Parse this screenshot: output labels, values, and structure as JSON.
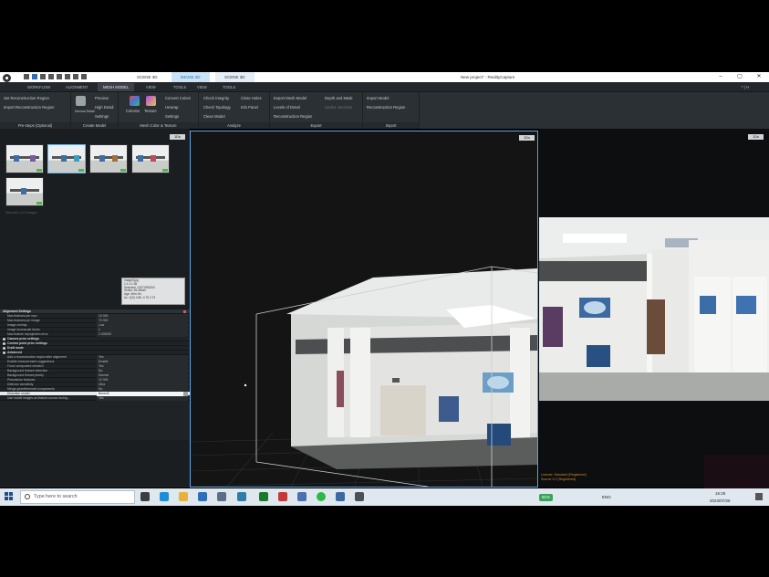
{
  "titlebar": {
    "tabs": [
      {
        "label": "SCENE 3D",
        "active": false
      },
      {
        "label": "IMAGE 2D",
        "active": true
      },
      {
        "label": "SCENE 3D",
        "active": false
      }
    ],
    "title": "New project* - RealityCapture",
    "minimize": "–",
    "maximize": "▢",
    "close": "✕"
  },
  "menu": {
    "tabs": [
      "WORKFLOW",
      "ALIGNMENT",
      "MESH MODEL",
      "VIEW",
      "TOOLS",
      "VIEW",
      "TOOLS"
    ],
    "active_index": 2,
    "help": "? | H"
  },
  "ribbon": {
    "prestep": {
      "items": [
        "Set Reconstruction Region",
        "Import Reconstruction Region"
      ],
      "label": "Pre-steps (Optional)"
    },
    "create": {
      "items": [
        "Preview",
        "High Detail",
        "Normal Detail",
        "Settings"
      ],
      "label": "Create Model"
    },
    "meshcolor": {
      "items": [
        "Colorize",
        "Texture"
      ],
      "label": "Mesh Color & Texture"
    },
    "tools": {
      "items": [
        "Convert Colors",
        "Unwrap",
        "Settings"
      ]
    },
    "analyze": {
      "items": [
        "Check Integrity",
        "Check Topology",
        "Clean Model",
        "Close Holes",
        "Info Panel"
      ],
      "label": "Analyze"
    },
    "export": {
      "items": [
        "Export Mesh Model",
        "Levels of Detail",
        "Reconstruction Region",
        "Depth and Mask",
        "Undist. Sections"
      ],
      "label": "Export"
    },
    "import": {
      "items": [
        "Import Model",
        "Reconstruction Region"
      ],
      "label": "Import"
    }
  },
  "leftpanel": {
    "view_badge": "1Ds",
    "hint": "Selected 1/13 images",
    "tooltip": [
      "Image0.jpg",
      "1:1:1:1:38",
      "Selected: 10071082200",
      "Vertex: 56 48mm",
      "Age: 46m 2m",
      "Ac: 1(2l) 0.86, 0.75 2.73"
    ]
  },
  "settings": {
    "header": "Alignment Settings",
    "rows": [
      {
        "k": "Max features per mpx",
        "v": "10 000"
      },
      {
        "k": "Max features per image",
        "v": "70 000"
      },
      {
        "k": "Image overlap",
        "v": "Low"
      },
      {
        "k": "Image downscale factor",
        "v": "1"
      },
      {
        "k": "Max feature reprojection error",
        "v": "2.000000"
      }
    ],
    "sections": [
      "Camera prior settings",
      "Control point prior settings",
      "Draft mode",
      "Advanced"
    ],
    "advanced": [
      {
        "k": "Add a reconstruction region after alignment",
        "v": "Yes"
      },
      {
        "k": "Enable measurement suggestions",
        "v": "Enable"
      },
      {
        "k": "Force component rematch",
        "v": "Yes"
      },
      {
        "k": "Background feature detection",
        "v": "No"
      },
      {
        "k": "Background thread priority",
        "v": "Normal"
      },
      {
        "k": "Preselector features",
        "v": "10 000"
      },
      {
        "k": "Detector sensitivity",
        "v": "Ultra"
      },
      {
        "k": "Merge georeferenced components",
        "v": "No"
      },
      {
        "k": "Distortion model",
        "v": "Brown3"
      },
      {
        "k": "Use model images as feature-source during...",
        "v": "Yes"
      }
    ],
    "highlight_index": 8
  },
  "viewport": {
    "badge": "1Ds"
  },
  "rightpanel": {
    "badge": "1Ds"
  },
  "log": {
    "lines": [
      "Licence: Standard (Registered)",
      "Source 3.2 (Registered)"
    ]
  },
  "taskbar": {
    "search_placeholder": "Type here to search",
    "battery": "91%",
    "lang": "ENG",
    "time": "16:25",
    "date": "2023/07/26"
  }
}
